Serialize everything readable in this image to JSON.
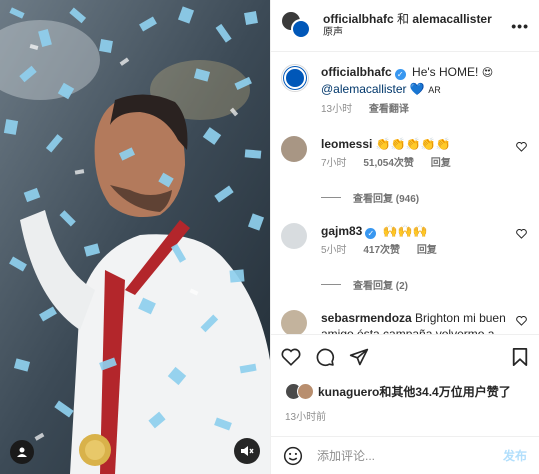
{
  "post": {
    "header": {
      "account": "officialbhafc",
      "joiner": "和",
      "collaborator": "alemacallister",
      "audio": "原声",
      "more": "•••"
    },
    "caption": {
      "account": "officialbhafc",
      "text": "He's HOME!",
      "mention": "@alemacallister",
      "suffix": "AR",
      "time": "13小时",
      "translate": "查看翻译"
    },
    "comments": [
      {
        "username": "leomessi",
        "text": "👏👏👏👏👏",
        "time": "7小时",
        "likes": "51,054次赞",
        "reply": "回复",
        "view_replies": "查看回复 (946)"
      },
      {
        "username": "gajm83",
        "text": "🙌🙌🙌",
        "time": "5小时",
        "likes": "417次赞",
        "reply": "回复",
        "view_replies": "查看回复 (2)"
      },
      {
        "username": "sebasrmendoza",
        "text": "Brighton mi buen amigo ésta campaña volvermo a estar contigo 💙"
      }
    ],
    "likes": {
      "user": "kunaguero",
      "rest": "和其他34.4万位用户赞了"
    },
    "time_ago": "13小时前",
    "add_comment": {
      "placeholder": "添加评论...",
      "post": "发布"
    }
  },
  "colors": {
    "verified": "#3897f0",
    "brand_blue": "#0057b8",
    "confetti": "#8fd0ee",
    "post_button": "#b2dffc"
  }
}
